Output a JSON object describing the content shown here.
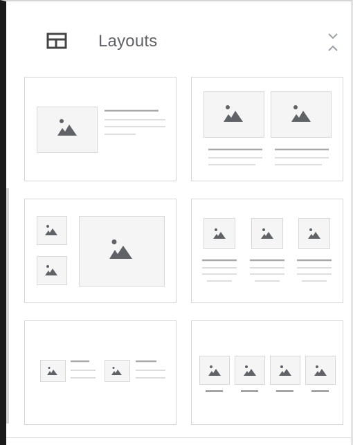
{
  "panel": {
    "title": "Layouts",
    "header_icon": "layouts-icon",
    "collapse_icon": "unfold-less-icon"
  },
  "layouts": [
    {
      "id": "image-left-text-right",
      "icon": "image-icon"
    },
    {
      "id": "two-images-with-captions",
      "icon": "image-icon"
    },
    {
      "id": "two-small-images-one-large",
      "icon": "image-icon"
    },
    {
      "id": "three-images-with-captions",
      "icon": "image-icon"
    },
    {
      "id": "two-image-text-rows",
      "icon": "image-icon"
    },
    {
      "id": "four-images-with-captions",
      "icon": "image-icon"
    }
  ],
  "colors": {
    "icon": "#5f6368",
    "placeholder_border": "#d8d8d8",
    "placeholder_fill": "#f5f5f5",
    "line_dark": "#a8a8a8",
    "line_light": "#d4d4d4",
    "card_border": "#d5d5d5"
  }
}
